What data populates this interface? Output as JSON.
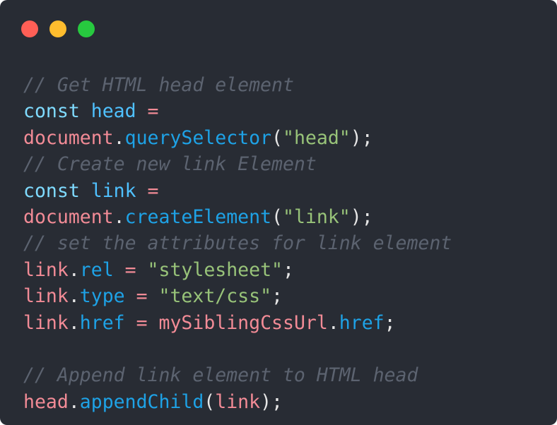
{
  "window": {
    "controls": [
      {
        "name": "close",
        "color": "#ff5f56"
      },
      {
        "name": "minimize",
        "color": "#ffbd2e"
      },
      {
        "name": "maximize",
        "color": "#27c93f"
      }
    ]
  },
  "colors": {
    "background": "#282c34",
    "comment": "#5c6370",
    "keyword": "#7fdbff",
    "const_name": "#4fc1ff",
    "variable": "#f28b96",
    "method": "#1ea2e6",
    "string": "#98c379",
    "punct": "#e6e6e6",
    "operator": "#f28b96"
  },
  "code_lines": [
    [
      {
        "t": "// Get HTML head element",
        "k": "comment"
      }
    ],
    [
      {
        "t": "const",
        "k": "keyword"
      },
      {
        "t": " ",
        "k": "punct"
      },
      {
        "t": "head",
        "k": "const_name"
      },
      {
        "t": " =",
        "k": "operator"
      }
    ],
    [
      {
        "t": "document",
        "k": "variable"
      },
      {
        "t": ".",
        "k": "punct"
      },
      {
        "t": "querySelector",
        "k": "method"
      },
      {
        "t": "(",
        "k": "punct"
      },
      {
        "t": "\"head\"",
        "k": "string"
      },
      {
        "t": ");",
        "k": "punct"
      }
    ],
    [
      {
        "t": "// Create new link Element",
        "k": "comment"
      }
    ],
    [
      {
        "t": "const",
        "k": "keyword"
      },
      {
        "t": " ",
        "k": "punct"
      },
      {
        "t": "link",
        "k": "const_name"
      },
      {
        "t": " =",
        "k": "operator"
      }
    ],
    [
      {
        "t": "document",
        "k": "variable"
      },
      {
        "t": ".",
        "k": "punct"
      },
      {
        "t": "createElement",
        "k": "method"
      },
      {
        "t": "(",
        "k": "punct"
      },
      {
        "t": "\"link\"",
        "k": "string"
      },
      {
        "t": ");",
        "k": "punct"
      }
    ],
    [
      {
        "t": "// set the attributes for link element",
        "k": "comment"
      }
    ],
    [
      {
        "t": "link",
        "k": "variable"
      },
      {
        "t": ".",
        "k": "punct"
      },
      {
        "t": "rel",
        "k": "method"
      },
      {
        "t": " = ",
        "k": "operator"
      },
      {
        "t": "\"stylesheet\"",
        "k": "string"
      },
      {
        "t": ";",
        "k": "punct"
      }
    ],
    [
      {
        "t": "link",
        "k": "variable"
      },
      {
        "t": ".",
        "k": "punct"
      },
      {
        "t": "type",
        "k": "method"
      },
      {
        "t": " = ",
        "k": "operator"
      },
      {
        "t": "\"text/css\"",
        "k": "string"
      },
      {
        "t": ";",
        "k": "punct"
      }
    ],
    [
      {
        "t": "link",
        "k": "variable"
      },
      {
        "t": ".",
        "k": "punct"
      },
      {
        "t": "href",
        "k": "method"
      },
      {
        "t": " = ",
        "k": "operator"
      },
      {
        "t": "mySiblingCssUrl",
        "k": "variable"
      },
      {
        "t": ".",
        "k": "punct"
      },
      {
        "t": "href",
        "k": "method"
      },
      {
        "t": ";",
        "k": "punct"
      }
    ],
    [],
    [
      {
        "t": "// Append link element to HTML head",
        "k": "comment"
      }
    ],
    [
      {
        "t": "head",
        "k": "variable"
      },
      {
        "t": ".",
        "k": "punct"
      },
      {
        "t": "appendChild",
        "k": "method"
      },
      {
        "t": "(",
        "k": "punct"
      },
      {
        "t": "link",
        "k": "variable"
      },
      {
        "t": ");",
        "k": "punct"
      }
    ]
  ]
}
